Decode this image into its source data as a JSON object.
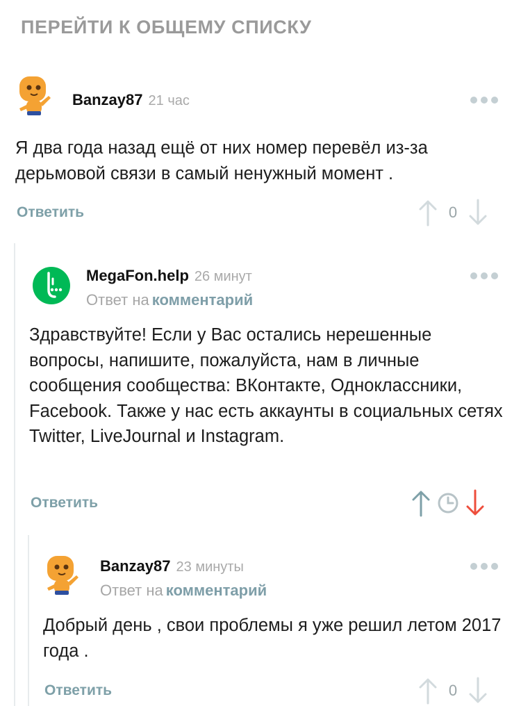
{
  "header": {
    "back_label": "ПЕРЕЙТИ К ОБЩЕМУ СПИСКУ"
  },
  "comments": [
    {
      "author": "Banzay87",
      "time": "21 час",
      "text": "Я два года назад ещё от них номер перевёл из-за дерьмовой связи в самый ненужный момент .",
      "reply_label": "Ответить",
      "rating": "0"
    },
    {
      "author": "MegaFon.help",
      "time": "26 минут",
      "reply_prefix": "Ответ на",
      "reply_link": "комментарий",
      "text": "Здравствуйте! Если у Вас остались нерешенные вопросы, напишите, пожалуйста, нам в личные сообщения сообщества: ВКонтакте, Одноклассники, Facebook. Также у нас есть аккаунты в социальных сетях Twitter, LiveJournal и Instagram.",
      "reply_label": "Ответить",
      "downvote_active_color": "#ee4e3c"
    },
    {
      "author": "Banzay87",
      "time": "23 минуты",
      "reply_prefix": "Ответ на",
      "reply_link": "комментарий",
      "text": "Добрый день , свои проблемы я уже решил летом 2017 года .",
      "reply_label": "Ответить",
      "rating": "0"
    }
  ],
  "colors": {
    "accent": "#7ea0a8",
    "megafon_green": "#00b956",
    "muted": "#c4cfd3"
  }
}
